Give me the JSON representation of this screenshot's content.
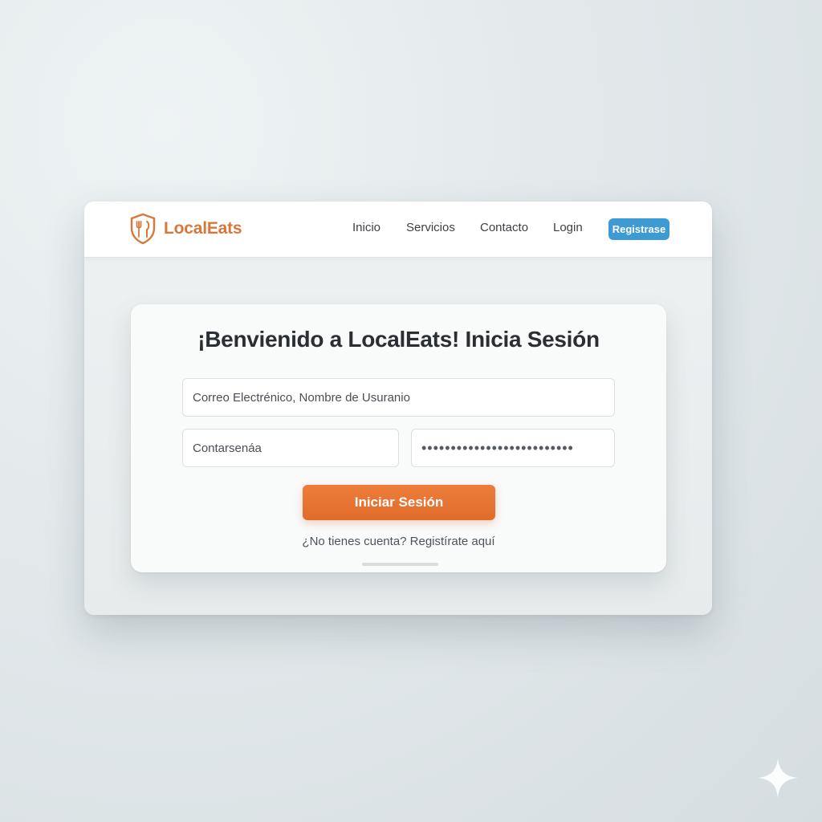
{
  "brand": {
    "name": "LocalEats",
    "icon": "shield-fork-knife-icon",
    "color": "#d8773a"
  },
  "nav": {
    "items": [
      "Inicio",
      "Servicios",
      "Contacto",
      "Login"
    ],
    "register_label": "Registrase",
    "register_color": "#3d9ad3"
  },
  "login": {
    "title": "¡Benvienido a LocalEats! Inicia Sesión",
    "email_placeholder": "Correo Electrénico, Nombre de Usuranio",
    "password_label_placeholder": "Contarsenáa",
    "password_value": "••••••••••••••••••••••••••",
    "submit_label": "Iniciar Sesión",
    "submit_color": "#e8742f",
    "signup_text": "¿No tienes cuenta? Registírate aquí"
  },
  "decoration": {
    "corner_icon": "sparkle-icon"
  }
}
